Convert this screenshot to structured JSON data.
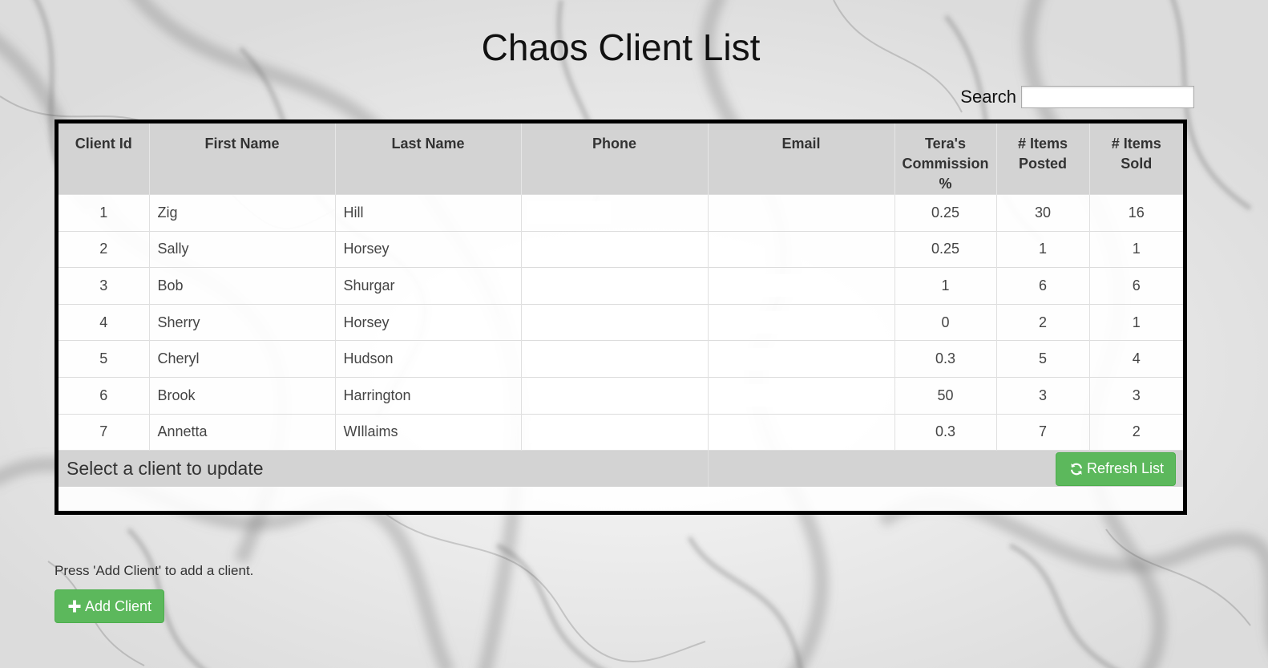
{
  "page": {
    "title": "Chaos Client List"
  },
  "search": {
    "label": "Search",
    "value": "",
    "placeholder": ""
  },
  "table": {
    "columns": [
      "Client Id",
      "First Name",
      "Last Name",
      "Phone",
      "Email",
      "Tera's Commission %",
      "# Items Posted",
      "# Items Sold"
    ],
    "rows": [
      {
        "id": "1",
        "first": "Zig",
        "last": "Hill",
        "commission": "0.25",
        "posted": "30",
        "sold": "16"
      },
      {
        "id": "2",
        "first": "Sally",
        "last": "Horsey",
        "commission": "0.25",
        "posted": "1",
        "sold": "1"
      },
      {
        "id": "3",
        "first": "Bob",
        "last": "Shurgar",
        "commission": "1",
        "posted": "6",
        "sold": "6"
      },
      {
        "id": "4",
        "first": "Sherry",
        "last": "Horsey",
        "commission": "0",
        "posted": "2",
        "sold": "1"
      },
      {
        "id": "5",
        "first": "Cheryl",
        "last": "Hudson",
        "commission": "0.3",
        "posted": "5",
        "sold": "4"
      },
      {
        "id": "6",
        "first": "Brook",
        "last": "Harrington",
        "commission": "50",
        "posted": "3",
        "sold": "3"
      },
      {
        "id": "7",
        "first": "Annetta",
        "last": "WIllaims",
        "commission": "0.3",
        "posted": "7",
        "sold": "2"
      }
    ],
    "footer_text": "Select a client to update",
    "refresh_label": "Refresh List",
    "refresh_icon": "refresh-icon"
  },
  "add": {
    "hint": "Press 'Add Client' to add a client.",
    "button_label": "Add Client",
    "button_icon": "plus-icon"
  },
  "colors": {
    "button_green": "#5cb85c",
    "header_gray": "#d3d3d3",
    "frame_border": "#000000"
  }
}
